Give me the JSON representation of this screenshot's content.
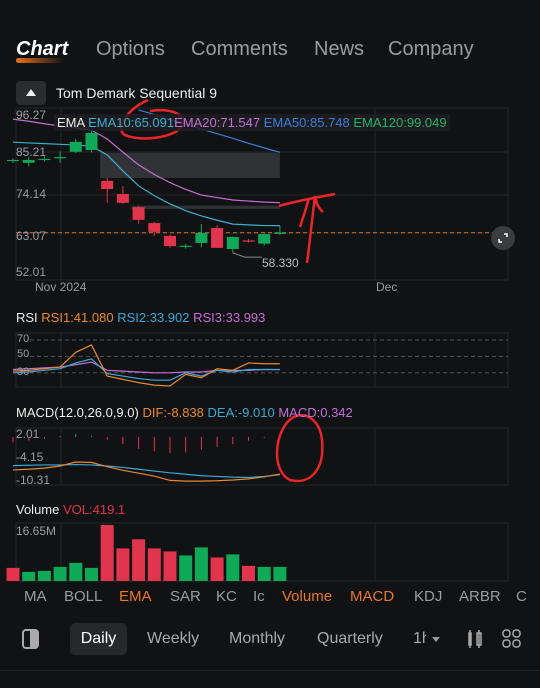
{
  "tabs": [
    {
      "label": "Chart",
      "active": true
    },
    {
      "label": "Options"
    },
    {
      "label": "Comments"
    },
    {
      "label": "News"
    },
    {
      "label": "Company"
    }
  ],
  "study": {
    "name": "Tom Demark Sequential 9"
  },
  "colors": {
    "up": "#0fa958",
    "down": "#e0354c",
    "ema10": "#3bb0d0",
    "ema20": "#c56fd6",
    "ema50": "#3a7fd8",
    "ema120": "#22b36b",
    "rsi1": "#e8892e",
    "rsi2": "#3aa8d8",
    "rsi3": "#c56fd6",
    "dif": "#e8892e",
    "dea": "#3aa8d8",
    "accent": "#e8772e",
    "annotation": "#e8262a"
  },
  "main": {
    "ema_legend": {
      "label": "EMA",
      "ema10": "EMA10:65.091",
      "ema20": "EMA20:71.547",
      "ema50": "EMA50:85.748",
      "ema120": "EMA120:99.049"
    },
    "y_ticks": [
      "96.27",
      "85.21",
      "74.14",
      "63.07",
      "52.01"
    ],
    "x_labels": [
      "Nov 2024",
      "Dec"
    ],
    "last_price": 63.07,
    "low_label": "58.330",
    "candles": [
      [
        83.6,
        83.6,
        84.0,
        82.8
      ],
      [
        82.8,
        83.6,
        84.4,
        81.8
      ],
      [
        83.9,
        83.9,
        84.6,
        83.2
      ],
      [
        84.3,
        84.4,
        86.0,
        82.8
      ],
      [
        85.9,
        88.7,
        89.5,
        85.5
      ],
      [
        86.4,
        91.2,
        92.0,
        85.7
      ],
      [
        77.7,
        75.4,
        78.5,
        71.5
      ],
      [
        74.0,
        71.5,
        76.2,
        71.2
      ],
      [
        70.3,
        66.7,
        70.6,
        65.6
      ],
      [
        65.8,
        63.3,
        66.1,
        62.2
      ],
      [
        62.2,
        59.3,
        62.5,
        58.8
      ],
      [
        59.2,
        59.4,
        60.0,
        58.6
      ],
      [
        60.2,
        63.0,
        65.5,
        59.0
      ],
      [
        64.4,
        58.8,
        65.2,
        58.8
      ],
      [
        58.5,
        61.9,
        62.0,
        57.4
      ],
      [
        60.9,
        60.7,
        61.3,
        60.3
      ],
      [
        60.0,
        62.7,
        62.9,
        59.4
      ],
      [
        63.0,
        63.1,
        65.0,
        62.4
      ]
    ],
    "ema10": [
      88.6,
      88.4,
      88.2,
      88.0,
      87.8,
      87.5,
      85.0,
      80.5,
      76.3,
      73.5,
      71.2,
      69.3,
      67.8,
      66.6,
      65.5,
      65.3,
      65.1,
      65.09
    ],
    "ema20": [
      95.1,
      94.5,
      93.8,
      93.2,
      92.6,
      92.0,
      89.5,
      85.8,
      82.2,
      79.5,
      77.2,
      75.3,
      73.7,
      73.0,
      72.3,
      72.0,
      71.7,
      71.55
    ],
    "ema50": [
      null,
      null,
      null,
      null,
      null,
      null,
      null,
      null,
      97.7,
      96.4,
      95.0,
      93.7,
      92.3,
      91.0,
      89.7,
      88.3,
      87.0,
      85.75
    ],
    "zones": [
      {
        "top": 85.6,
        "bottom": 78.5,
        "from": 6,
        "to": 17
      },
      {
        "top": 70.7,
        "bottom": 69.8,
        "from": 8,
        "to": 17
      }
    ]
  },
  "rsi": {
    "label": "RSI",
    "rsi1": "RSI1:41.080",
    "rsi2": "RSI2:33.902",
    "rsi3": "RSI3:33.993",
    "y_ticks": [
      "70",
      "50",
      "30"
    ],
    "series1": [
      32,
      33,
      35,
      37,
      55,
      64,
      26,
      22,
      18,
      15,
      14,
      28,
      24,
      35,
      33,
      42,
      41,
      41.08
    ],
    "series2": [
      30,
      31,
      33,
      35,
      42,
      47,
      29,
      26,
      23,
      21,
      21,
      30,
      26,
      33,
      31,
      34,
      34,
      33.9
    ],
    "series3": [
      34,
      35,
      36,
      37,
      40,
      43,
      33,
      32,
      31,
      30,
      30,
      31,
      31,
      33,
      33,
      33,
      34,
      33.99
    ]
  },
  "macd": {
    "label": "MACD(12.0,26.0,9.0)",
    "dif": "DIF:-8.838",
    "dea": "DEA:-9.010",
    "macd": "MACD:0.342",
    "y_ticks": [
      "2.01",
      "-4.15",
      "-10.31"
    ],
    "hist": [
      -0.6,
      -0.4,
      -0.2,
      0.2,
      0.6,
      0.2,
      -0.3,
      -0.8,
      -1.3,
      -1.6,
      -1.8,
      -1.7,
      -1.4,
      -1.1,
      -0.8,
      -0.4,
      -0.1,
      0.34
    ],
    "dif_series": [
      -7.7,
      -7.5,
      -7.2,
      -6.6,
      -5.5,
      -5.6,
      -6.8,
      -7.8,
      -8.6,
      -9.4,
      -10.6,
      -10.8,
      -10.8,
      -10.7,
      -10.5,
      -10.2,
      -9.6,
      -8.84
    ],
    "dea_series": [
      -6.5,
      -6.4,
      -6.3,
      -6.3,
      -6.2,
      -6.3,
      -6.6,
      -7.0,
      -7.5,
      -8.0,
      -8.5,
      -8.9,
      -9.3,
      -9.5,
      -9.7,
      -9.8,
      -9.5,
      -9.01
    ]
  },
  "volume": {
    "label": "Volume",
    "vol": "VOL:419.1",
    "y_tick": "16.65M",
    "max": 16.65,
    "values": [
      3.9,
      2.7,
      3.0,
      4.2,
      5.4,
      3.9,
      16.65,
      9.7,
      12.4,
      9.7,
      8.8,
      7.6,
      10.0,
      7.0,
      7.9,
      4.5,
      4.2,
      4.2
    ],
    "up": [
      false,
      true,
      true,
      true,
      true,
      true,
      false,
      false,
      false,
      false,
      false,
      true,
      true,
      false,
      true,
      false,
      true,
      true
    ]
  },
  "indicators": [
    {
      "label": "MA"
    },
    {
      "label": "BOLL"
    },
    {
      "label": "EMA",
      "active": true
    },
    {
      "label": "SAR"
    },
    {
      "label": "KC"
    },
    {
      "label": "Ic"
    },
    {
      "label": "Volume",
      "active": true
    },
    {
      "label": "MACD",
      "active": true
    },
    {
      "label": "KDJ"
    },
    {
      "label": "ARBR"
    },
    {
      "label": "C"
    }
  ],
  "periods": [
    {
      "label": "Daily",
      "active": true
    },
    {
      "label": "Weekly"
    },
    {
      "label": "Monthly"
    },
    {
      "label": "Quarterly"
    },
    {
      "label": "1h"
    }
  ]
}
